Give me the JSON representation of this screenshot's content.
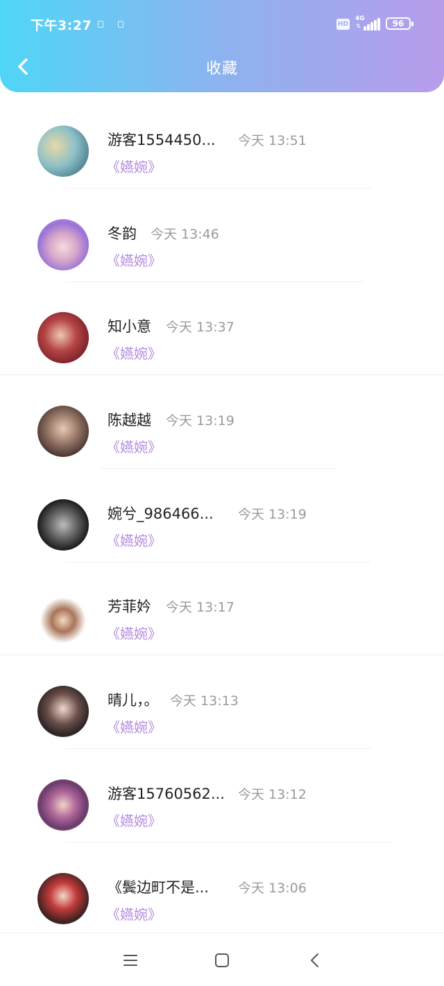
{
  "status_bar": {
    "time": "下午3:27",
    "hd": "HD",
    "network": "4G",
    "battery": "96"
  },
  "header": {
    "title": "收藏",
    "back_icon": "chevron-left-icon"
  },
  "favorites": [
    {
      "name": "游客1554450...",
      "time": "今天 13:51",
      "work": "《嬿婉》"
    },
    {
      "name": "冬韵",
      "time": "今天 13:46",
      "work": "《嬿婉》"
    },
    {
      "name": "知小意",
      "time": "今天 13:37",
      "work": "《嬿婉》"
    },
    {
      "name": "陈越越",
      "time": "今天 13:19",
      "work": "《嬿婉》"
    },
    {
      "name": "婉兮_986466...",
      "time": "今天 13:19",
      "work": "《嬿婉》"
    },
    {
      "name": "芳菲妗",
      "time": "今天 13:17",
      "work": "《嬿婉》"
    },
    {
      "name": "晴儿，。",
      "time": "今天 13:13",
      "work": "《嬿婉》"
    },
    {
      "name": "游客15760562...",
      "time": "今天 13:12",
      "work": "《嬿婉》"
    },
    {
      "name": "《鬓边町不是...",
      "time": "今天 13:06",
      "work": "《嬿婉》"
    }
  ],
  "nav_bar": {
    "menu_icon": "menu-icon",
    "home_icon": "home-square-icon",
    "back_icon": "back-triangle-icon"
  },
  "colors": {
    "header_gradient_start": "#4fd6f6",
    "header_gradient_end": "#b89cec",
    "work_title": "#b48be0",
    "time_text": "#9a9a9a"
  }
}
